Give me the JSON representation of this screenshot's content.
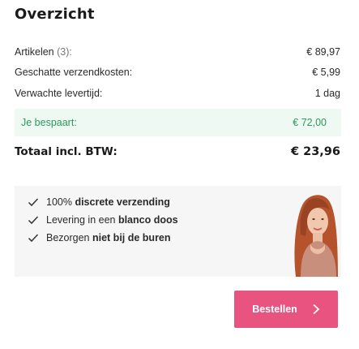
{
  "summary": {
    "title": "Overzicht",
    "items": [
      {
        "label": "Artikelen",
        "suffix": "(3):",
        "value": "€ 89,97"
      },
      {
        "label": "Geschatte verzendkosten:",
        "value": "€ 5,99"
      },
      {
        "label": "Verwachte levertijd:",
        "value": "1 dag"
      }
    ],
    "savings": {
      "label": "Je bespaart:",
      "value": "€ 72,00"
    },
    "total": {
      "label": "Totaal incl. BTW:",
      "value": "€ 23,96"
    }
  },
  "usps": [
    {
      "prefix": "100% ",
      "bold": "discrete verzending",
      "suffix": ""
    },
    {
      "prefix": "Levering in een ",
      "bold": "blanco doos",
      "suffix": ""
    },
    {
      "prefix": "Bezorgen ",
      "bold": "niet bij de buren",
      "suffix": ""
    }
  ],
  "icons": {
    "usp_check": "check-icon",
    "cta_arrow": "chevron-right-icon"
  },
  "cta": {
    "label": "Bestellen"
  },
  "colors": {
    "accent": "#e8537f",
    "savings_text": "#2c9a5a",
    "savings_bg": "#eef9f3",
    "usp_bg": "#f6f6f6"
  }
}
